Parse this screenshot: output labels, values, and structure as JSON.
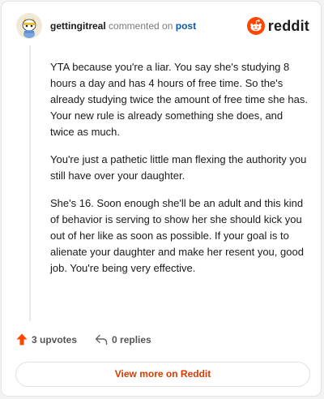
{
  "header": {
    "username": "gettingitreal",
    "action_text": "commented on",
    "post_link": "post",
    "brand": "reddit"
  },
  "comment": {
    "paragraphs": [
      "YTA because you're a liar. You say she's studying 8 hours a day and has 4 hours of free time. So the's already studying twice the amount of free time she has. Your new rule is already something she does, and twice as much.",
      "You're just a pathetic little man flexing the authority you still have over your daughter.",
      "She's 16. Soon enough she'll be an adult and this kind of behavior is serving to show her she should kick you out of her like as soon as possible. If your goal is to alienate your daughter and make her resent you, good job. You're being very effective."
    ]
  },
  "actions": {
    "upvotes": "3 upvotes",
    "replies": "0 replies"
  },
  "footer": {
    "view_more": "View more on Reddit"
  },
  "colors": {
    "brand_orange": "#ff4500",
    "link_blue": "#0a5aa8",
    "button_text": "#d93a00"
  },
  "icons": {
    "avatar": "snoo-avatar-icon",
    "brand": "reddit-logo-icon",
    "upvote": "upvote-arrow-icon",
    "reply": "reply-arrow-icon"
  }
}
